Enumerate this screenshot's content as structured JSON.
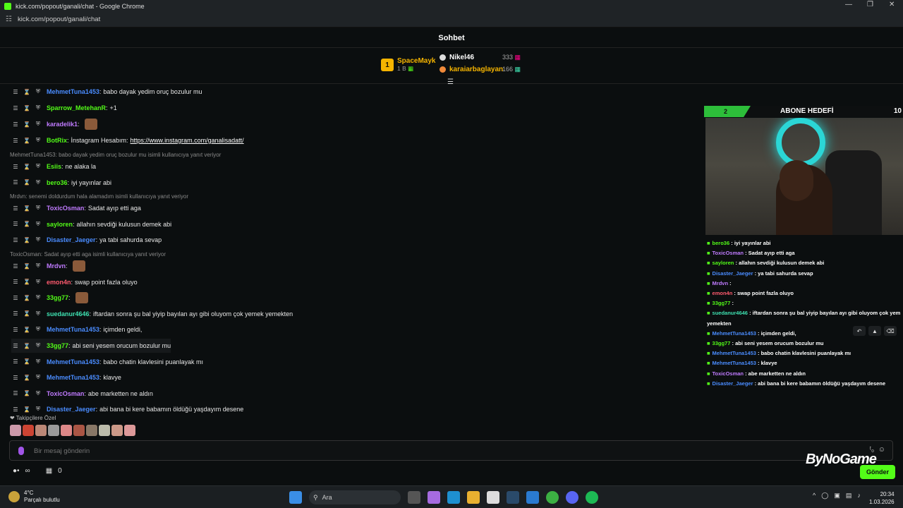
{
  "window": {
    "title": "kick.com/popout/ganali/chat - Google Chrome",
    "url": "kick.com/popout/ganali/chat"
  },
  "chat": {
    "header": "Sohbet"
  },
  "leaderboard": {
    "first": {
      "rank": "1",
      "name": "SpaceMayk",
      "sub": "1 B"
    },
    "rows": [
      {
        "name": "Nikel46",
        "count": "333",
        "color": "#ffffff"
      },
      {
        "name": "karaiarbaglayan",
        "count": "166",
        "color": "#f5b400"
      }
    ]
  },
  "messages": [
    {
      "user": "MehmetTuna1453",
      "color": "#4a8cff",
      "text": "babo dayak yedim oruç bozulur mu"
    },
    {
      "user": "Sparrow_MetehanR",
      "color": "#53fc18",
      "text": "+1"
    },
    {
      "user": "karadelik1",
      "color": "#c07bff",
      "text": ""
    },
    {
      "user": "BotRix",
      "color": "#53fc18",
      "text": "İnstagram Hesabım:",
      "link": "https://www.instagram.com/ganalisadatt/"
    },
    {
      "reply": "MehmetTuna1453: babo dayak yedim oruç bozulur mu isimli kullanıcıya yanıt veriyor"
    },
    {
      "user": "Esiis",
      "color": "#53fc18",
      "text": "ne alaka la"
    },
    {
      "user": "bero36",
      "color": "#53fc18",
      "text": "iyi yayınlar abi"
    },
    {
      "reply": "Mrdvn: senemi doldurdum hala alamadım isimli kullanıcıya yanıt veriyor"
    },
    {
      "user": "ToxicOsman",
      "color": "#c07bff",
      "text": "Sadat ayıp etti aga"
    },
    {
      "user": "sayloren",
      "color": "#53fc18",
      "text": "allahın sevdiği kulusun demek abi"
    },
    {
      "user": "Disaster_Jaeger",
      "color": "#4a8cff",
      "text": "ya tabi sahurda sevap"
    },
    {
      "reply": "ToxicOsman: Sadat ayıp etti aga isimli kullanıcıya yanıt veriyor"
    },
    {
      "user": "Mrdvn",
      "color": "#c07bff",
      "text": ""
    },
    {
      "user": "emon4n",
      "color": "#ff5a6e",
      "text": "swap point fazla oluyo"
    },
    {
      "user": "33gg77",
      "color": "#53fc18",
      "text": ""
    },
    {
      "user": "suedanur4646",
      "color": "#3ee0b0",
      "text": "iftardan sonra şu bal yiyip bayılan ayı gibi oluyom çok yemek yemekten"
    },
    {
      "user": "MehmetTuna1453",
      "color": "#4a8cff",
      "text": "içimden geldi,"
    },
    {
      "user": "33gg77",
      "color": "#53fc18",
      "text": "abi seni yesem orucum bozulur mu"
    },
    {
      "user": "MehmetTuna1453",
      "color": "#4a8cff",
      "text": "babo chatin klavlesini puanlayak mı"
    },
    {
      "user": "MehmetTuna1453",
      "color": "#4a8cff",
      "text": "klavye"
    },
    {
      "user": "ToxicOsman",
      "color": "#c07bff",
      "text": "abe marketten ne aldın"
    },
    {
      "user": "Disaster_Jaeger",
      "color": "#4a8cff",
      "text": "abi bana bi kere babamın öldüğü yaşdayım desene"
    }
  ],
  "follower_label": "Takipçilere Özel",
  "input": {
    "placeholder": "Bir mesaj gönderin",
    "send_label": "Gönder"
  },
  "bottom": {
    "points": "∞",
    "count": "0"
  },
  "overlay": {
    "goal_current": "2",
    "goal_title": "ABONE HEDEFİ",
    "goal_max": "10",
    "chat": [
      {
        "user": "bero36",
        "color": "#53fc18",
        "text": "iyi yayınlar abi"
      },
      {
        "user": "ToxicOsman",
        "color": "#c07bff",
        "text": "Sadat ayıp etti aga"
      },
      {
        "user": "sayloren",
        "color": "#53fc18",
        "text": "allahın sevdiği kulusun demek abi"
      },
      {
        "user": "Disaster_Jaeger",
        "color": "#4a8cff",
        "text": "ya tabi sahurda sevap"
      },
      {
        "user": "Mrdvn",
        "color": "#c07bff",
        "text": ""
      },
      {
        "user": "emon4n",
        "color": "#ff5a6e",
        "text": "swap point fazla oluyo"
      },
      {
        "user": "33gg77",
        "color": "#53fc18",
        "text": ""
      },
      {
        "user": "suedanur4646",
        "color": "#3ee0b0",
        "text": "iftardan sonra şu bal yiyip bayılan ayı gibi oluyom çok yem"
      },
      {
        "user": "",
        "color": "#fff",
        "text": "yemekten"
      },
      {
        "user": "MehmetTuna1453",
        "color": "#4a8cff",
        "text": "içimden geldi,"
      },
      {
        "user": "33gg77",
        "color": "#53fc18",
        "text": "abi seni yesem orucum bozulur mu"
      },
      {
        "user": "MehmetTuna1453",
        "color": "#4a8cff",
        "text": "babo chatin klavlesini puanlayak mı"
      },
      {
        "user": "MehmetTuna1453",
        "color": "#4a8cff",
        "text": "klavye"
      },
      {
        "user": "ToxicOsman",
        "color": "#c07bff",
        "text": "abe marketten ne aldın"
      },
      {
        "user": "Disaster_Jaeger",
        "color": "#4a8cff",
        "text": "abi bana bi kere babamın öldüğü yaşdayım desene"
      }
    ],
    "brand": "ByNoGame"
  },
  "taskbar": {
    "weather_temp": "4°C",
    "weather_desc": "Parçalı bulutlu",
    "search_label": "Ara",
    "time": "20:34",
    "date": "1.03.2026"
  }
}
